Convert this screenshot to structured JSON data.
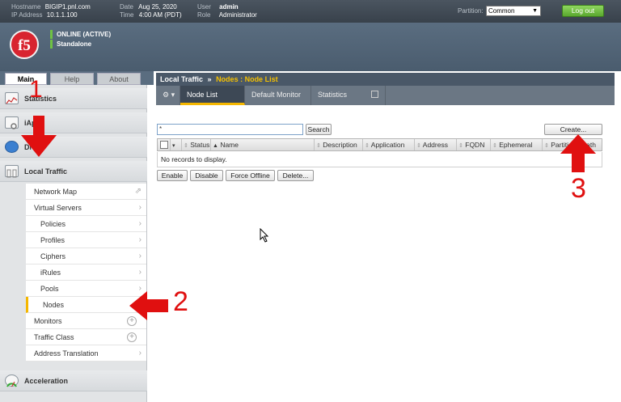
{
  "topbar": {
    "hostname_label": "Hostname",
    "hostname": "BIGIP1.pnl.com",
    "ip_label": "IP Address",
    "ip": "10.1.1.100",
    "date_label": "Date",
    "date": "Aug 25, 2020",
    "time_label": "Time",
    "time": "4:00 AM (PDT)",
    "user_label": "User",
    "user": "admin",
    "role_label": "Role",
    "role": "Administrator",
    "partition_label": "Partition:",
    "partition_value": "Common",
    "logout_label": "Log out"
  },
  "header": {
    "logo_text": "f5",
    "status_line1": "ONLINE (ACTIVE)",
    "status_line2": "Standalone"
  },
  "left_tabs": [
    "Main",
    "Help",
    "About"
  ],
  "nav": {
    "statistics": "Statistics",
    "iapps": "iApps",
    "dns": "DNS",
    "local_traffic": "Local Traffic",
    "acceleration": "Acceleration",
    "subitems": [
      {
        "label": "Network Map",
        "suffix": "⇗"
      },
      {
        "label": "Virtual Servers",
        "suffix": "›"
      },
      {
        "label": "Policies",
        "suffix": "›"
      },
      {
        "label": "Profiles",
        "suffix": "›"
      },
      {
        "label": "Ciphers",
        "suffix": "›"
      },
      {
        "label": "iRules",
        "suffix": "›"
      },
      {
        "label": "Pools",
        "suffix": "›"
      },
      {
        "label": "Nodes",
        "suffix": ""
      },
      {
        "label": "Monitors",
        "suffix": "+"
      },
      {
        "label": "Traffic Class",
        "suffix": "+"
      },
      {
        "label": "Address Translation",
        "suffix": "›"
      }
    ]
  },
  "breadcrumb": {
    "section": "Local Traffic",
    "sep": "»",
    "path": "Nodes : Node List"
  },
  "tabs": {
    "gear": "⚙ ▾",
    "node_list": "Node List",
    "default_monitor": "Default Monitor",
    "statistics": "Statistics"
  },
  "search": {
    "value": "*",
    "button": "Search"
  },
  "create_button": "Create...",
  "table": {
    "columns": [
      "Status",
      "Name",
      "Description",
      "Application",
      "Address",
      "FQDN",
      "Ephemeral",
      "Partition / Path"
    ],
    "empty_message": "No records to display."
  },
  "actions": [
    "Enable",
    "Disable",
    "Force Offline",
    "Delete..."
  ],
  "annotations": [
    "1",
    "2",
    "3"
  ],
  "colors": {
    "annotation_red": "#e01010",
    "accent_yellow": "#f5b700",
    "logout_green": "#6fc243"
  }
}
